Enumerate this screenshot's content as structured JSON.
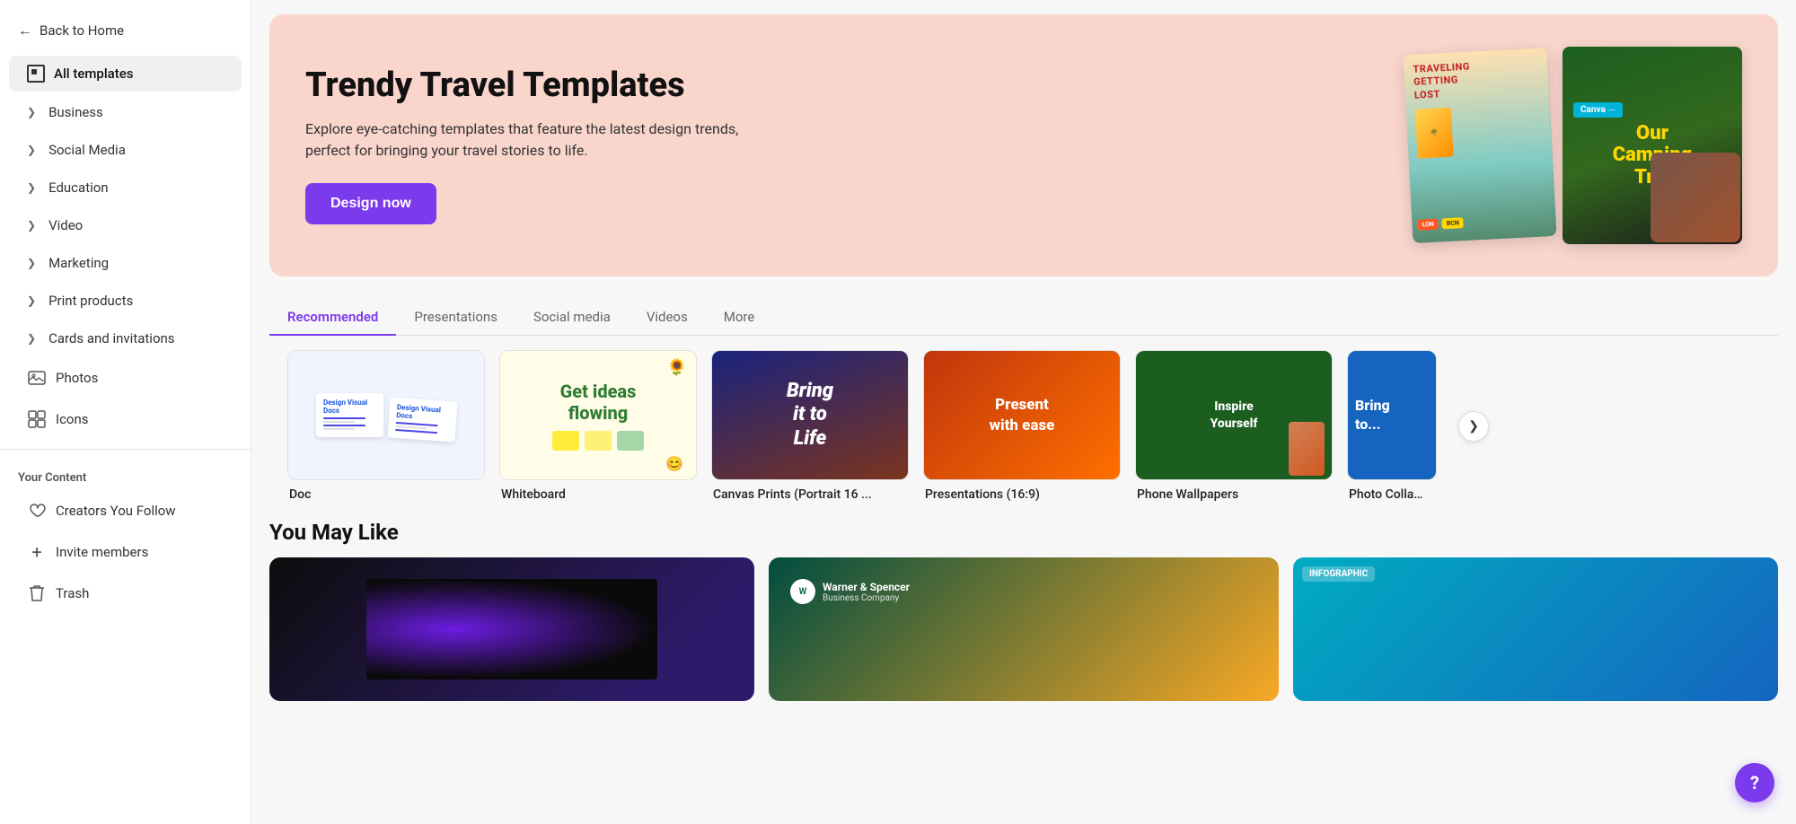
{
  "sidebar": {
    "back_label": "Back to Home",
    "active_item": "All templates",
    "items": [
      {
        "id": "business",
        "label": "Business",
        "has_chevron": true
      },
      {
        "id": "social-media",
        "label": "Social Media",
        "has_chevron": true
      },
      {
        "id": "education",
        "label": "Education",
        "has_chevron": true
      },
      {
        "id": "video",
        "label": "Video",
        "has_chevron": true
      },
      {
        "id": "marketing",
        "label": "Marketing",
        "has_chevron": true
      },
      {
        "id": "print-products",
        "label": "Print products",
        "has_chevron": true
      },
      {
        "id": "cards",
        "label": "Cards and invitations",
        "has_chevron": true
      }
    ],
    "special_items": [
      {
        "id": "photos",
        "label": "Photos",
        "icon": "🖼️"
      },
      {
        "id": "icons",
        "label": "Icons",
        "icon": "✦"
      }
    ],
    "your_content_label": "Your Content",
    "content_items": [
      {
        "id": "creators",
        "label": "Creators You Follow",
        "icon": "♥"
      },
      {
        "id": "invite",
        "label": "Invite members",
        "icon": "+"
      },
      {
        "id": "trash",
        "label": "Trash",
        "icon": "🗑"
      }
    ]
  },
  "hero": {
    "title": "Trendy Travel Templates",
    "subtitle": "Explore eye-catching templates that feature the latest design trends, perfect for bringing your travel stories to life.",
    "cta_label": "Design now",
    "img1_label": "TRAVELING GETTING LOST",
    "img2_top": "Canva",
    "img2_title": "Our Camping Trip"
  },
  "tabs": [
    {
      "id": "recommended",
      "label": "Recommended",
      "active": true
    },
    {
      "id": "presentations",
      "label": "Presentations",
      "active": false
    },
    {
      "id": "social-media",
      "label": "Social media",
      "active": false
    },
    {
      "id": "videos",
      "label": "Videos",
      "active": false
    },
    {
      "id": "more",
      "label": "More",
      "active": false
    }
  ],
  "template_cards": [
    {
      "id": "doc",
      "label": "Doc"
    },
    {
      "id": "whiteboard",
      "label": "Whiteboard",
      "text": "Get ideas flowing"
    },
    {
      "id": "canvas-prints",
      "label": "Canvas Prints (Portrait 16 ...",
      "text": "Bring it to Life"
    },
    {
      "id": "presentations",
      "label": "Presentations (16:9)",
      "text": "Present with ease"
    },
    {
      "id": "phone-wallpapers",
      "label": "Phone Wallpapers",
      "text": "Inspire Yourself"
    },
    {
      "id": "photo-collage",
      "label": "Photo Colla…",
      "text": "Bring to..."
    }
  ],
  "you_may_like": {
    "title": "You May Like",
    "cards": [
      {
        "id": "dark-card"
      },
      {
        "id": "business-card",
        "brand": "Warner & Spencer",
        "subtitle": "Business Company"
      },
      {
        "id": "infographic-card",
        "label": "INFOGRAPHIC"
      }
    ]
  },
  "help_btn": "?"
}
